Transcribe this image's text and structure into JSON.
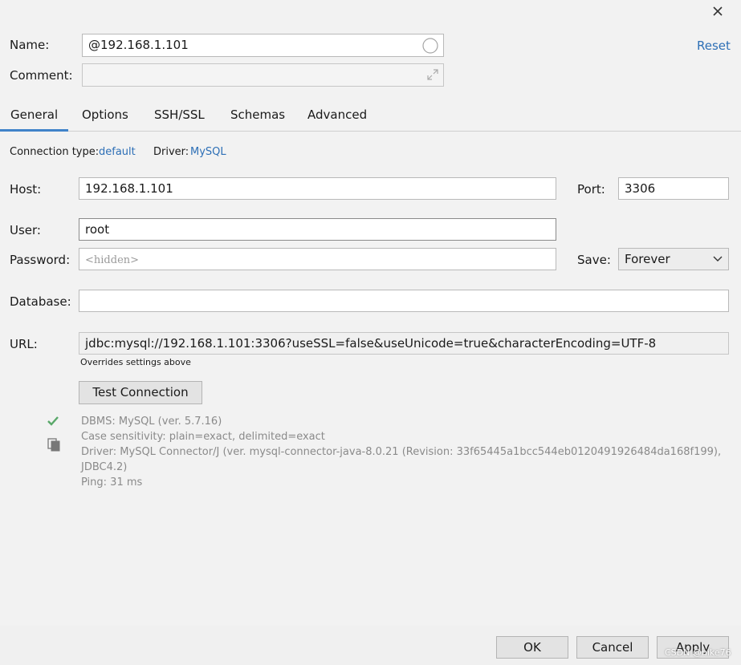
{
  "dialog": {
    "close_icon": "close-icon"
  },
  "header": {
    "name_label": "Name:",
    "name_value": "@192.168.1.101",
    "comment_label": "Comment:",
    "comment_value": "",
    "reset_label": "Reset"
  },
  "tabs": [
    {
      "label": "General",
      "active": true
    },
    {
      "label": "Options",
      "active": false
    },
    {
      "label": "SSH/SSL",
      "active": false
    },
    {
      "label": "Schemas",
      "active": false
    },
    {
      "label": "Advanced",
      "active": false
    }
  ],
  "general": {
    "connection_type_label": "Connection type:",
    "connection_type_value": "default",
    "driver_label": "Driver:",
    "driver_value": "MySQL",
    "host_label": "Host:",
    "host_value": "192.168.1.101",
    "port_label": "Port:",
    "port_value": "3306",
    "user_label": "User:",
    "user_value": "root",
    "password_label": "Password:",
    "password_placeholder": "<hidden>",
    "save_label": "Save:",
    "save_value": "Forever",
    "database_label": "Database:",
    "database_value": "",
    "url_label": "URL:",
    "url_value": "jdbc:mysql://192.168.1.101:3306?useSSL=false&useUnicode=true&characterEncoding=UTF-8",
    "url_hint": "Overrides settings above",
    "test_connection_label": "Test Connection"
  },
  "status": {
    "lines": [
      "DBMS: MySQL (ver. 5.7.16)",
      "Case sensitivity: plain=exact, delimited=exact",
      "Driver: MySQL Connector/J (ver. mysql-connector-java-8.0.21 (Revision: 33f65445a1bcc544eb0120491926484da168f199),",
      "JDBC4.2)",
      "Ping: 31 ms"
    ],
    "success_color": "#59a869"
  },
  "footer": {
    "ok_label": "OK",
    "cancel_label": "Cancel",
    "apply_label": "Apply",
    "watermark": "CSDN @nike76"
  },
  "colors": {
    "accent": "#2d6fb6",
    "active_tab_underline": "#4083c9"
  }
}
